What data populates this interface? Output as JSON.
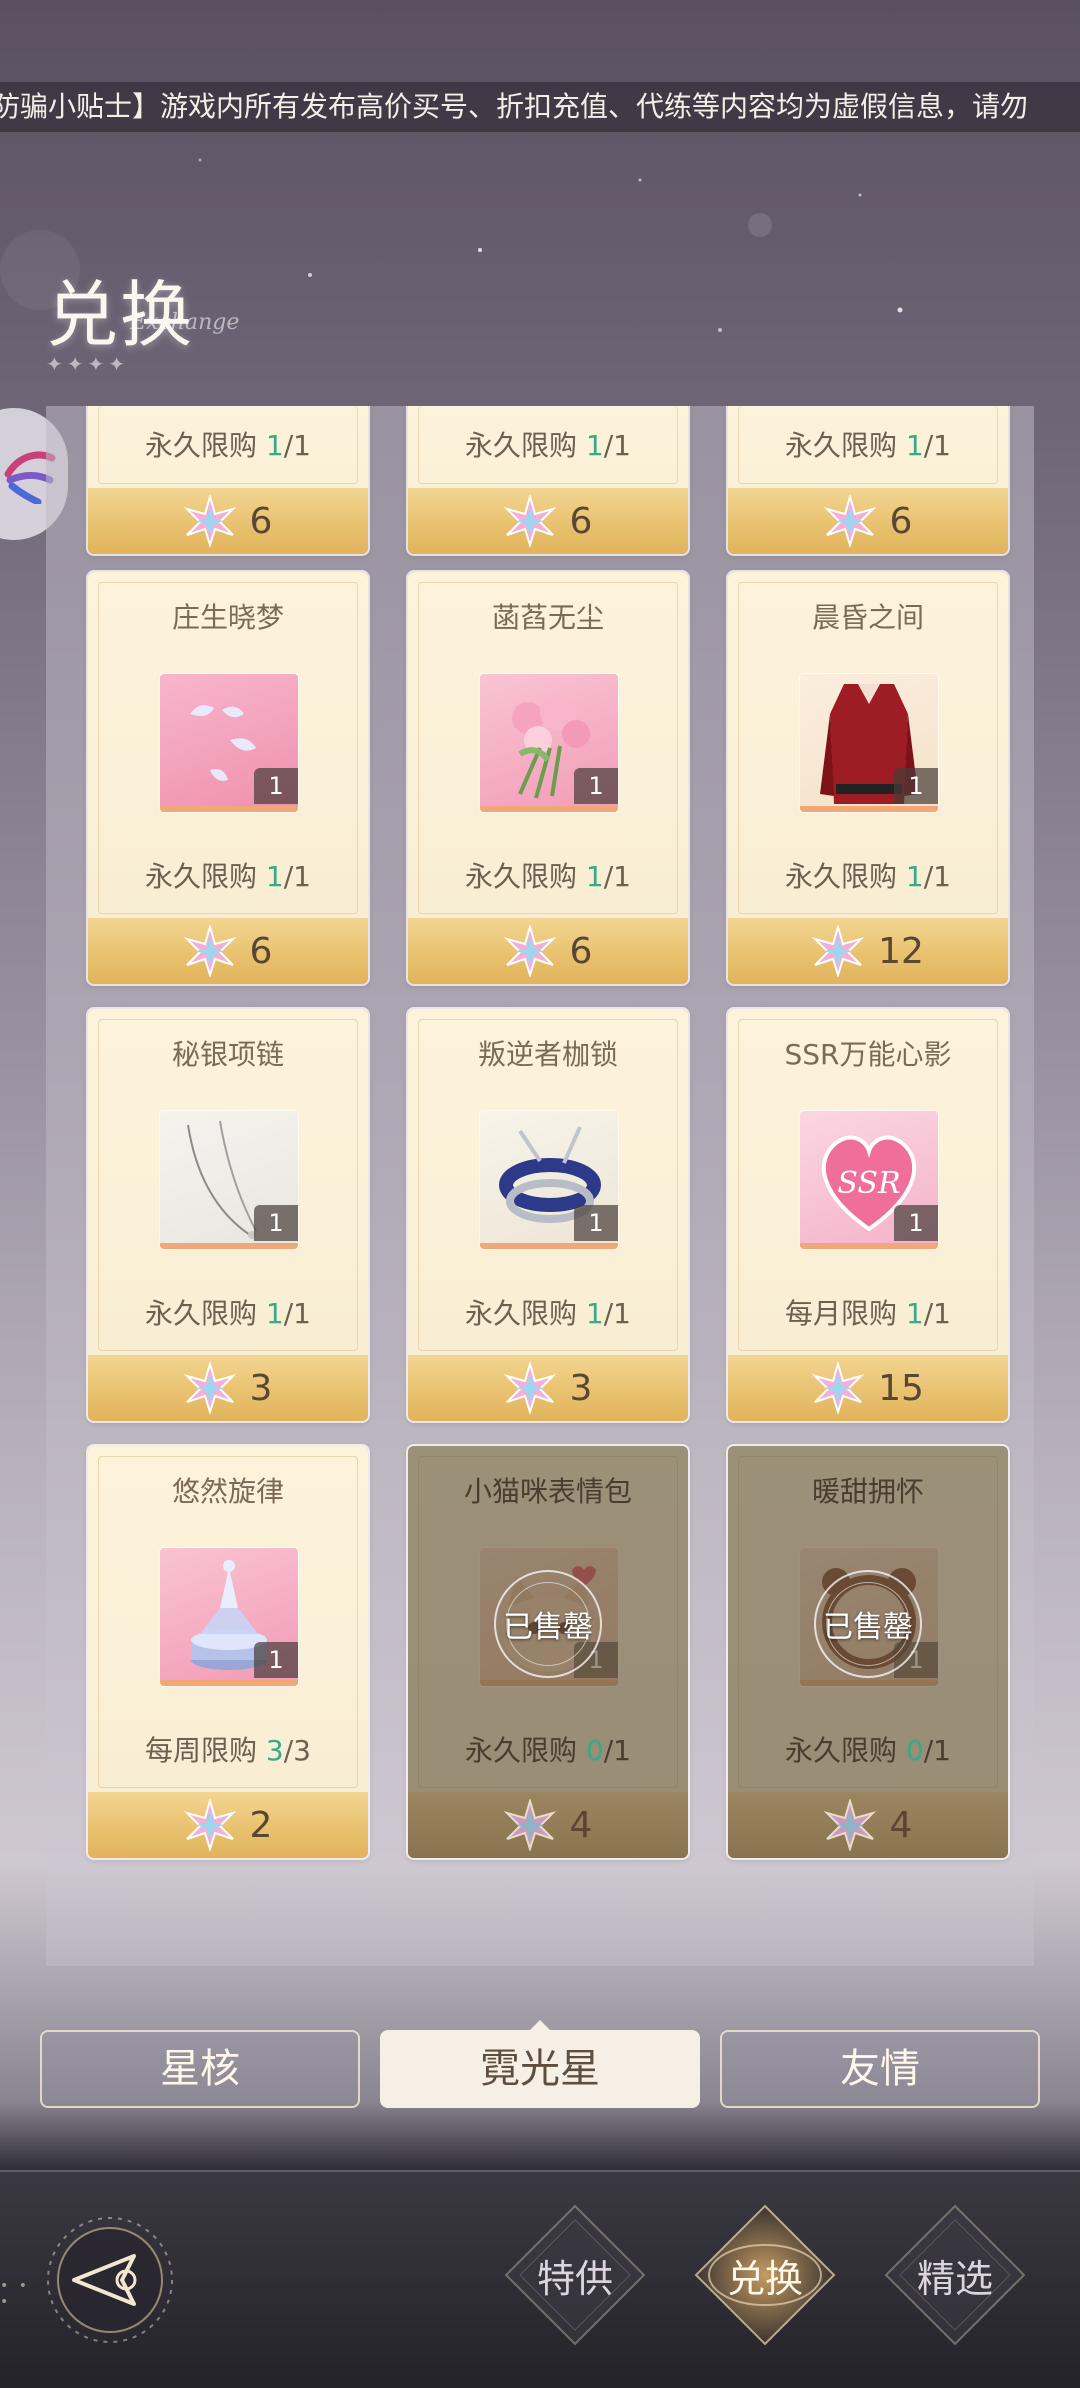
{
  "notice": {
    "text": "防骗小贴士】游戏内所有发布高价买号、折扣充值、代练等内容均为虚假信息，请勿"
  },
  "header": {
    "title": "兑换",
    "title_en": "Exchange"
  },
  "cards_partial": [
    {
      "limit_label": "永久限购",
      "bought": "1",
      "total": "1",
      "price": "6"
    },
    {
      "limit_label": "永久限购",
      "bought": "1",
      "total": "1",
      "price": "6"
    },
    {
      "limit_label": "永久限购",
      "bought": "1",
      "total": "1",
      "price": "6"
    }
  ],
  "cards": [
    {
      "name": "庄生晓梦",
      "qty": "1",
      "limit_label": "永久限购",
      "bought": "1",
      "total": "1",
      "price": "6",
      "sold": false,
      "icon": "butterflies-icon"
    },
    {
      "name": "菡萏无尘",
      "qty": "1",
      "limit_label": "永久限购",
      "bought": "1",
      "total": "1",
      "price": "6",
      "sold": false,
      "icon": "bouquet-icon"
    },
    {
      "name": "晨昏之间",
      "qty": "1",
      "limit_label": "永久限购",
      "bought": "1",
      "total": "1",
      "price": "12",
      "sold": false,
      "icon": "shirt-icon"
    },
    {
      "name": "秘银项链",
      "qty": "1",
      "limit_label": "永久限购",
      "bought": "1",
      "total": "1",
      "price": "3",
      "sold": false,
      "icon": "necklace-icon"
    },
    {
      "name": "叛逆者枷锁",
      "qty": "1",
      "limit_label": "永久限购",
      "bought": "1",
      "total": "1",
      "price": "3",
      "sold": false,
      "icon": "shackle-icon"
    },
    {
      "name": "SSR万能心影",
      "qty": "1",
      "limit_label": "每月限购",
      "bought": "1",
      "total": "1",
      "price": "15",
      "sold": false,
      "icon": "ssr-heart-icon"
    },
    {
      "name": "悠然旋律",
      "qty": "1",
      "limit_label": "每周限购",
      "bought": "3",
      "total": "3",
      "price": "2",
      "sold": false,
      "icon": "music-box-icon"
    },
    {
      "name": "小猫咪表情包",
      "qty": "1",
      "limit_label": "永久限购",
      "bought": "0",
      "total": "1",
      "price": "4",
      "sold": true,
      "sold_text": "已售罄",
      "icon": "cat-sticker-icon"
    },
    {
      "name": "暖甜拥怀",
      "qty": "1",
      "limit_label": "永久限购",
      "bought": "0",
      "total": "1",
      "price": "4",
      "sold": true,
      "sold_text": "已售罄",
      "icon": "bear-frame-icon"
    }
  ],
  "tabs": [
    {
      "label": "星核",
      "active": false
    },
    {
      "label": "霓光星",
      "active": true
    },
    {
      "label": "友情",
      "active": false
    }
  ],
  "nav": [
    {
      "label": "特供",
      "active": false
    },
    {
      "label": "兑换",
      "active": true
    },
    {
      "label": "精选",
      "active": false
    }
  ],
  "colors": {
    "accent_count": "#3aa88a",
    "price_bar": "#e9c270",
    "card_bg": "#fbf1d8"
  }
}
